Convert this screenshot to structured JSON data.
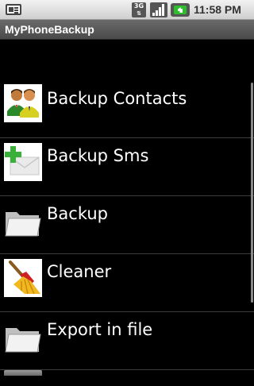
{
  "status_bar": {
    "network_type": "3G",
    "time": "11:58 PM"
  },
  "app": {
    "title": "MyPhoneBackup"
  },
  "menu": {
    "items": [
      {
        "label": "Backup Contacts",
        "icon": "contacts-icon"
      },
      {
        "label": "Backup Sms",
        "icon": "sms-add-icon"
      },
      {
        "label": "Backup",
        "icon": "folder-icon"
      },
      {
        "label": "Cleaner",
        "icon": "broom-icon"
      },
      {
        "label": "Export in file",
        "icon": "folder-icon"
      }
    ]
  },
  "colors": {
    "background": "#000000",
    "title_bar": "#5a5a5a",
    "status_bar": "#e0e0e0",
    "divider": "#3d3d3d",
    "battery_charge": "#2dbd2d"
  }
}
